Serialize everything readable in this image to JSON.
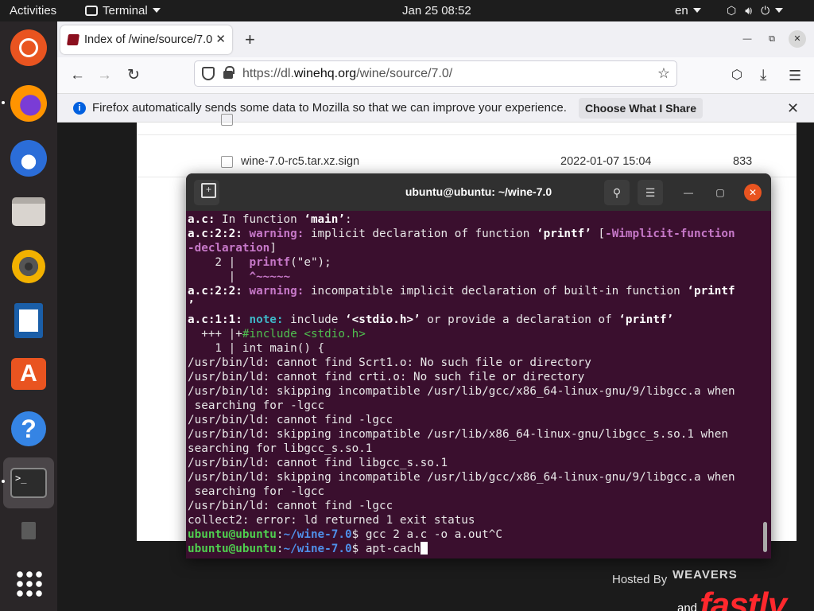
{
  "topbar": {
    "activities": "Activities",
    "app_name": "Terminal",
    "clock": "Jan 25  08:52",
    "lang": "en",
    "tray_icons": [
      "network-icon",
      "volume-icon",
      "power-icon"
    ]
  },
  "dock": {
    "items": [
      "ubuntu-software-icon",
      "firefox-icon",
      "thunderbird-icon",
      "files-icon",
      "rhythmbox-icon",
      "libreoffice-writer-icon",
      "app-store-icon",
      "help-icon",
      "terminal-icon",
      "trash-icon",
      "show-apps-icon"
    ]
  },
  "firefox": {
    "tab_title": "Index of /wine/source/7.0",
    "url_prefix": "https://dl.",
    "url_host": "winehq.org",
    "url_path": "/wine/source/7.0/",
    "notice": "Firefox automatically sends some data to Mozilla so that we can improve your experience.",
    "notice_button": "Choose What I Share",
    "listing": [
      {
        "name": "wine-7.0-rc5.tar.xz.sign",
        "date": "2022-01-07 15:04",
        "size": "833"
      }
    ],
    "sponsor_hosted": "Hosted By",
    "sponsor_cw": "WEAVERS",
    "sponsor_and": "and",
    "sponsor_fastly": "fastly"
  },
  "terminal": {
    "title": "ubuntu@ubuntu: ~/wine-7.0",
    "user": "ubuntu@ubuntu",
    "path": "~/wine-7.0",
    "lines": {
      "l1a": "a.c:",
      "l1b": " In function ",
      "l1c": "‘main’",
      "l1d": ":",
      "l2a": "a.c:2:2:",
      "l2b": " warning: ",
      "l2c": "implicit declaration of function ",
      "l2d": "‘printf’",
      "l2e": " [",
      "l2f": "-Wimplicit-function",
      "l3a": "-declaration",
      "l3b": "]",
      "l4a": "    2 |  ",
      "l4b": "printf",
      "l4c": "(\"e\");",
      "l5a": "      |  ",
      "l5b": "^~~~~~",
      "l6a": "a.c:2:2:",
      "l6b": " warning: ",
      "l6c": "incompatible implicit declaration of built-in function ",
      "l6d": "‘printf",
      "l7a": "’",
      "l8a": "a.c:1:1:",
      "l8b": " note: ",
      "l8c": "include ",
      "l8d": "‘<stdio.h>’",
      "l8e": " or provide a declaration of ",
      "l8f": "‘printf’",
      "l9a": "  +++ |+",
      "l9b": "#include <stdio.h>",
      "l10": "    1 | int main() {",
      "l11": "/usr/bin/ld: cannot find Scrt1.o: No such file or directory",
      "l12": "/usr/bin/ld: cannot find crti.o: No such file or directory",
      "l13": "/usr/bin/ld: skipping incompatible /usr/lib/gcc/x86_64-linux-gnu/9/libgcc.a when",
      "l14": " searching for -lgcc",
      "l15": "/usr/bin/ld: cannot find -lgcc",
      "l16": "/usr/bin/ld: skipping incompatible /usr/lib/x86_64-linux-gnu/libgcc_s.so.1 when",
      "l17": "searching for libgcc_s.so.1",
      "l18": "/usr/bin/ld: cannot find libgcc_s.so.1",
      "l19": "/usr/bin/ld: skipping incompatible /usr/lib/gcc/x86_64-linux-gnu/9/libgcc.a when",
      "l20": " searching for -lgcc",
      "l21": "/usr/bin/ld: cannot find -lgcc",
      "l22": "collect2: error: ld returned 1 exit status",
      "cmd1": "gcc 2 a.c -o a.out^C",
      "cmd2": "apt-cach"
    }
  }
}
